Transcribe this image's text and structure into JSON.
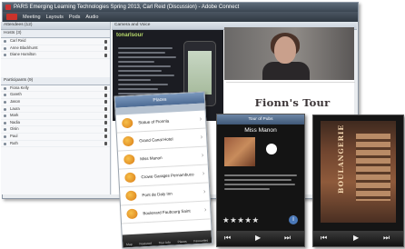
{
  "window": {
    "title": "PARS Emerging Learning Technologies Spring 2013, Carl Reid (Discussion) - Adobe Connect",
    "menus": [
      "Meeting",
      "Layouts",
      "Pods",
      "Audio"
    ]
  },
  "left_pod": {
    "header": "Attendees (12)",
    "section1": "Hosts (3)",
    "hosts": [
      "Carl Reid",
      "Anne Blackhurst",
      "Diane Hamilton"
    ],
    "section2": "Participants (9)",
    "participants": [
      "Fiona Kelly",
      "Gareth",
      "Jason",
      "Laura",
      "Mark",
      "Nadia",
      "Oisin",
      "Paul",
      "Ruth"
    ]
  },
  "share_pod": {
    "header": "Camera and Voice",
    "brand": "tonarlsour"
  },
  "slide": {
    "title": "Fionn's Tour"
  },
  "phone_list": {
    "title": "Places",
    "items": [
      "Statue of Fionnla",
      "Grand Canal Hotel",
      "Miss Manon",
      "Crowe Garages Pernambuco",
      "Pont de Daly Inn",
      "Boulevard Faubourg Saint"
    ],
    "tabs": [
      "Map",
      "Featured",
      "Tour Info",
      "Places",
      "Favourites"
    ]
  },
  "phone_detail": {
    "title": "Tour of Pubs",
    "name": "Miss Manon",
    "stars": "★★★★★",
    "info": "i"
  },
  "phone_photo": {
    "sign": "BOULANGERIE"
  }
}
